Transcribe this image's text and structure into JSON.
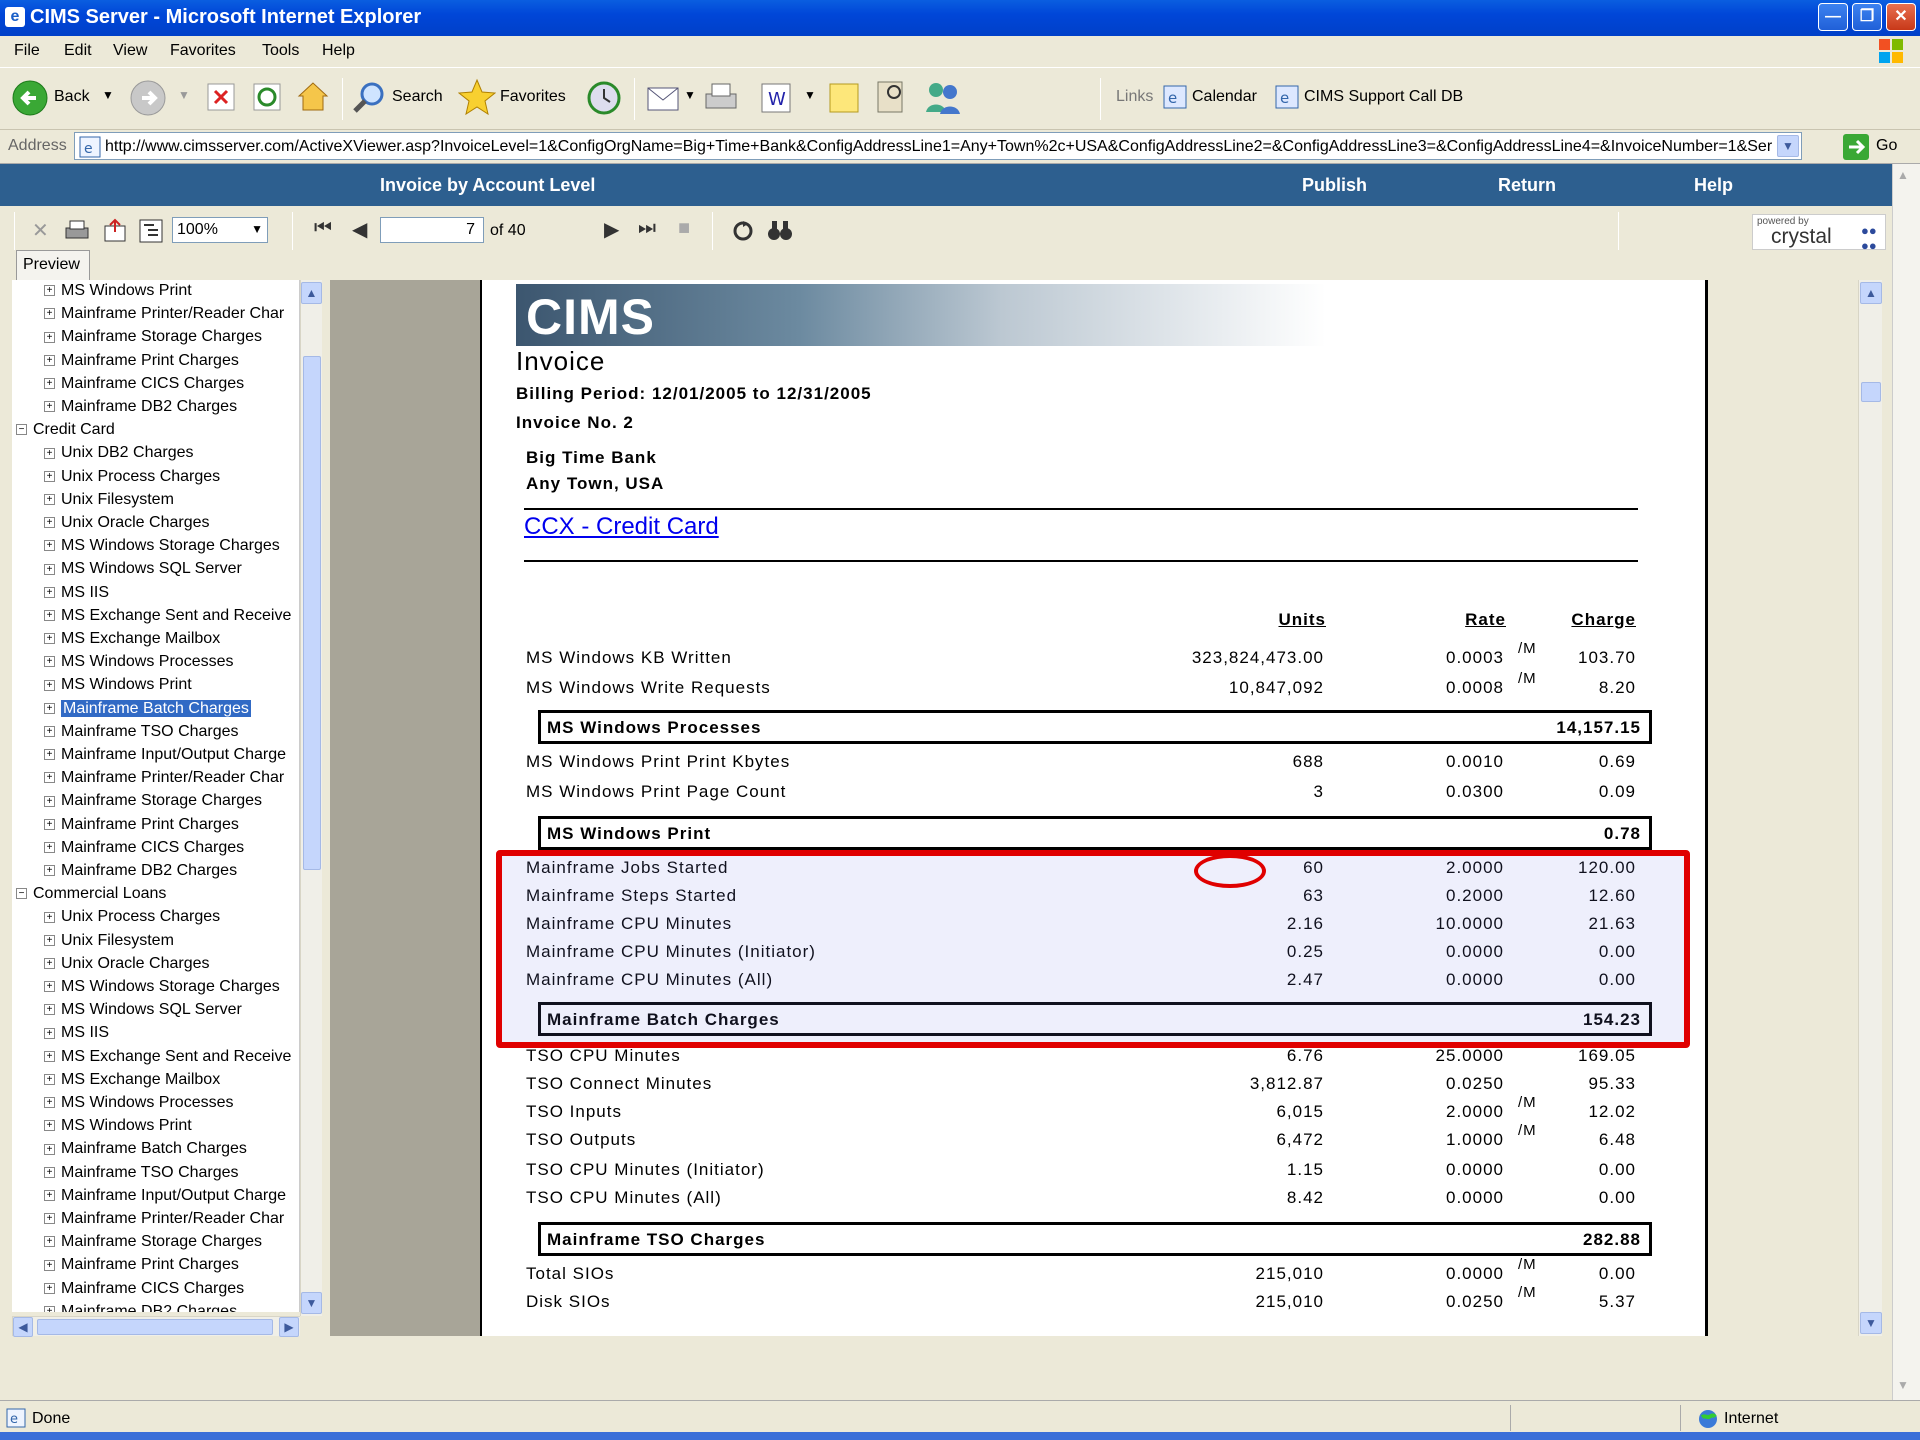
{
  "window": {
    "title": "CIMS Server - Microsoft Internet Explorer"
  },
  "menu": [
    "File",
    "Edit",
    "View",
    "Favorites",
    "Tools",
    "Help"
  ],
  "toolbar": {
    "back": "Back",
    "search": "Search",
    "favorites": "Favorites",
    "links": "Links",
    "calendar": "Calendar",
    "support": "CIMS Support Call DB"
  },
  "address": {
    "label": "Address",
    "url": "http://www.cimsserver.com/ActiveXViewer.asp?InvoiceLevel=1&ConfigOrgName=Big+Time+Bank&ConfigAddressLine1=Any+Town%2c+USA&ConfigAddressLine2=&ConfigAddressLine3=&ConfigAddressLine4=&InvoiceNumber=1&Ser",
    "go": "Go"
  },
  "viewer_header": {
    "title": "Invoice by Account Level",
    "publish": "Publish",
    "return": "Return",
    "help": "Help"
  },
  "crystal_toolbar": {
    "zoom": "100%",
    "page": "7",
    "of": "of 40",
    "powered": "powered by",
    "brand": "crystal"
  },
  "preview_tab": "Preview",
  "tree": [
    {
      "label": "MS Windows Print",
      "level": 2
    },
    {
      "label": "Mainframe Printer/Reader Char",
      "level": 2
    },
    {
      "label": "Mainframe Storage Charges",
      "level": 2
    },
    {
      "label": "Mainframe Print Charges",
      "level": 2
    },
    {
      "label": "Mainframe CICS Charges",
      "level": 2
    },
    {
      "label": "Mainframe DB2 Charges",
      "level": 2
    },
    {
      "label": "Credit Card",
      "level": 1
    },
    {
      "label": "Unix DB2 Charges",
      "level": 2
    },
    {
      "label": "Unix Process Charges",
      "level": 2
    },
    {
      "label": "Unix Filesystem",
      "level": 2
    },
    {
      "label": "Unix Oracle Charges",
      "level": 2
    },
    {
      "label": "MS Windows Storage Charges",
      "level": 2
    },
    {
      "label": "MS Windows SQL Server",
      "level": 2
    },
    {
      "label": "MS IIS",
      "level": 2
    },
    {
      "label": "MS Exchange Sent and Receive",
      "level": 2
    },
    {
      "label": "MS Exchange Mailbox",
      "level": 2
    },
    {
      "label": "MS Windows Processes",
      "level": 2
    },
    {
      "label": "MS Windows Print",
      "level": 2
    },
    {
      "label": "Mainframe Batch Charges",
      "level": 2,
      "selected": true
    },
    {
      "label": "Mainframe TSO Charges",
      "level": 2
    },
    {
      "label": "Mainframe Input/Output Charge",
      "level": 2
    },
    {
      "label": "Mainframe Printer/Reader Char",
      "level": 2
    },
    {
      "label": "Mainframe Storage Charges",
      "level": 2
    },
    {
      "label": "Mainframe Print Charges",
      "level": 2
    },
    {
      "label": "Mainframe CICS Charges",
      "level": 2
    },
    {
      "label": "Mainframe DB2 Charges",
      "level": 2
    },
    {
      "label": "Commercial Loans",
      "level": 1
    },
    {
      "label": "Unix Process Charges",
      "level": 2
    },
    {
      "label": "Unix Filesystem",
      "level": 2
    },
    {
      "label": "Unix Oracle Charges",
      "level": 2
    },
    {
      "label": "MS Windows Storage Charges",
      "level": 2
    },
    {
      "label": "MS Windows SQL Server",
      "level": 2
    },
    {
      "label": "MS IIS",
      "level": 2
    },
    {
      "label": "MS Exchange Sent and Receive",
      "level": 2
    },
    {
      "label": "MS Exchange Mailbox",
      "level": 2
    },
    {
      "label": "MS Windows Processes",
      "level": 2
    },
    {
      "label": "MS Windows Print",
      "level": 2
    },
    {
      "label": "Mainframe Batch Charges",
      "level": 2
    },
    {
      "label": "Mainframe TSO Charges",
      "level": 2
    },
    {
      "label": "Mainframe Input/Output Charge",
      "level": 2
    },
    {
      "label": "Mainframe Printer/Reader Char",
      "level": 2
    },
    {
      "label": "Mainframe Storage Charges",
      "level": 2
    },
    {
      "label": "Mainframe Print Charges",
      "level": 2
    },
    {
      "label": "Mainframe CICS Charges",
      "level": 2
    },
    {
      "label": "Mainframe DB2 Charges",
      "level": 2
    }
  ],
  "report": {
    "logo": "CIMS",
    "title": "Invoice",
    "billing_period": "Billing Period: 12/01/2005 to 12/31/2005",
    "invoice_no": "Invoice No.  2",
    "org_name": "Big Time Bank",
    "org_address": "Any Town, USA",
    "account_link": "CCX - Credit Card",
    "col_units": "Units",
    "col_rate": "Rate",
    "col_charge": "Charge",
    "rows": [
      {
        "desc": "MS Windows KB Written",
        "units": "323,824,473.00",
        "rate": "0.0003",
        "unit": "/M",
        "charge": "103.70"
      },
      {
        "desc": "MS Windows Write Requests",
        "units": "10,847,092",
        "rate": "0.0008",
        "unit": "/M",
        "charge": "8.20"
      },
      {
        "subtotal": "MS Windows Processes",
        "amount": "14,157.15"
      },
      {
        "desc": "MS Windows Print Print Kbytes",
        "units": "688",
        "rate": "0.0010",
        "unit": "",
        "charge": "0.69"
      },
      {
        "desc": "MS Windows Print Page Count",
        "units": "3",
        "rate": "0.0300",
        "unit": "",
        "charge": "0.09"
      },
      {
        "subtotal": "MS Windows Print",
        "amount": "0.78"
      },
      {
        "desc": "Mainframe Jobs Started",
        "units": "60",
        "rate": "2.0000",
        "unit": "",
        "charge": "120.00"
      },
      {
        "desc": "Mainframe Steps Started",
        "units": "63",
        "rate": "0.2000",
        "unit": "",
        "charge": "12.60"
      },
      {
        "desc": "Mainframe CPU Minutes",
        "units": "2.16",
        "rate": "10.0000",
        "unit": "",
        "charge": "21.63"
      },
      {
        "desc": "Mainframe CPU Minutes (Initiator)",
        "units": "0.25",
        "rate": "0.0000",
        "unit": "",
        "charge": "0.00"
      },
      {
        "desc": "Mainframe CPU Minutes (All)",
        "units": "2.47",
        "rate": "0.0000",
        "unit": "",
        "charge": "0.00"
      },
      {
        "subtotal": "Mainframe Batch Charges",
        "amount": "154.23"
      },
      {
        "desc": "TSO CPU Minutes",
        "units": "6.76",
        "rate": "25.0000",
        "unit": "",
        "charge": "169.05"
      },
      {
        "desc": "TSO Connect Minutes",
        "units": "3,812.87",
        "rate": "0.0250",
        "unit": "",
        "charge": "95.33"
      },
      {
        "desc": "TSO Inputs",
        "units": "6,015",
        "rate": "2.0000",
        "unit": "/M",
        "charge": "12.02"
      },
      {
        "desc": "TSO Outputs",
        "units": "6,472",
        "rate": "1.0000",
        "unit": "/M",
        "charge": "6.48"
      },
      {
        "desc": "TSO CPU Minutes (Initiator)",
        "units": "1.15",
        "rate": "0.0000",
        "unit": "",
        "charge": "0.00"
      },
      {
        "desc": "TSO CPU Minutes (All)",
        "units": "8.42",
        "rate": "0.0000",
        "unit": "",
        "charge": "0.00"
      },
      {
        "subtotal": "Mainframe TSO Charges",
        "amount": "282.88"
      },
      {
        "desc": "Total SIOs",
        "units": "215,010",
        "rate": "0.0000",
        "unit": "/M",
        "charge": "0.00"
      },
      {
        "desc": "Disk SIOs",
        "units": "215,010",
        "rate": "0.0250",
        "unit": "/M",
        "charge": "5.37"
      }
    ]
  },
  "status": {
    "text": "Done",
    "zone": "Internet"
  },
  "highlight_color": "#e00000"
}
